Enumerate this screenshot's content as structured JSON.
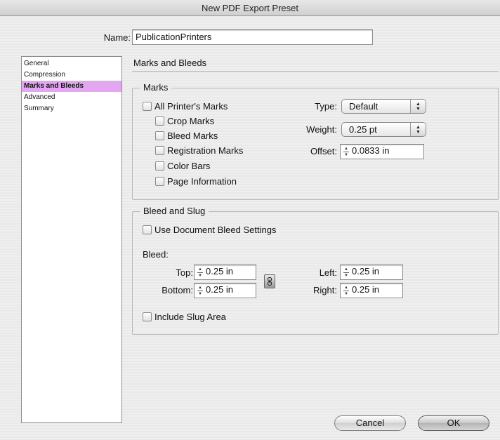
{
  "window": {
    "title": "New PDF Export Preset"
  },
  "name_field": {
    "label": "Name:",
    "value": "PublicationPrinters"
  },
  "sidebar": {
    "items": [
      {
        "label": "General",
        "selected": false
      },
      {
        "label": "Compression",
        "selected": false
      },
      {
        "label": "Marks and Bleeds",
        "selected": true
      },
      {
        "label": "Advanced",
        "selected": false
      },
      {
        "label": "Summary",
        "selected": false
      }
    ],
    "selected_color": "#e3a7f2"
  },
  "panel": {
    "title": "Marks and Bleeds"
  },
  "marks": {
    "legend": "Marks",
    "all_printers_marks": "All Printer's Marks",
    "crop_marks": "Crop Marks",
    "bleed_marks": "Bleed Marks",
    "registration_marks": "Registration Marks",
    "color_bars": "Color Bars",
    "page_information": "Page Information",
    "type_label": "Type:",
    "type_value": "Default",
    "weight_label": "Weight:",
    "weight_value": "0.25 pt",
    "offset_label": "Offset:",
    "offset_value": "0.0833 in"
  },
  "bleed_slug": {
    "legend": "Bleed and Slug",
    "use_document_bleed": "Use Document Bleed Settings",
    "bleed_label": "Bleed:",
    "top_label": "Top:",
    "top_value": "0.25 in",
    "bottom_label": "Bottom:",
    "bottom_value": "0.25 in",
    "left_label": "Left:",
    "left_value": "0.25 in",
    "right_label": "Right:",
    "right_value": "0.25 in",
    "include_slug": "Include Slug Area"
  },
  "buttons": {
    "cancel": "Cancel",
    "ok": "OK"
  }
}
